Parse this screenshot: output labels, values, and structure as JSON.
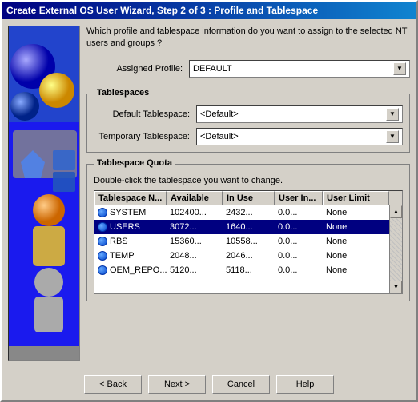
{
  "window": {
    "title": "Create External OS User Wizard, Step 2 of 3 : Profile and Tablespace"
  },
  "description": "Which profile and tablespace information do you want to assign to the selected NT users and groups ?",
  "assigned_profile": {
    "label": "Assigned Profile:",
    "label_underline": "A",
    "value": "DEFAULT"
  },
  "tablespaces_group_label": "Tablespaces",
  "default_tablespace": {
    "label": "Default Tablespace:",
    "label_underline": "D",
    "value": "<Default>"
  },
  "temporary_tablespace": {
    "label": "Temporary Tablespace:",
    "label_underline": "T",
    "value": "<Default>"
  },
  "tablespace_quota": {
    "group_label": "Tablespace Quota",
    "instruction": "Double-click the tablespace you want to change.",
    "columns": [
      "Tablespace N...",
      "Available",
      "In Use",
      "User In...",
      "User Limit"
    ],
    "rows": [
      {
        "name": "SYSTEM",
        "available": "102400...",
        "in_use": "2432...",
        "user_in": "0.0...",
        "user_limit": "None",
        "selected": false
      },
      {
        "name": "USERS",
        "available": "3072...",
        "in_use": "1640...",
        "user_in": "0.0...",
        "user_limit": "None",
        "selected": true
      },
      {
        "name": "RBS",
        "available": "15360...",
        "in_use": "10558...",
        "user_in": "0.0...",
        "user_limit": "None",
        "selected": false
      },
      {
        "name": "TEMP",
        "available": "2048...",
        "in_use": "2046...",
        "user_in": "0.0...",
        "user_limit": "None",
        "selected": false
      },
      {
        "name": "OEM_REPO...",
        "available": "5120...",
        "in_use": "5118...",
        "user_in": "0.0...",
        "user_limit": "None",
        "selected": false
      }
    ]
  },
  "buttons": {
    "back": "< Back",
    "next": "Next >",
    "cancel": "Cancel",
    "help": "Help"
  }
}
